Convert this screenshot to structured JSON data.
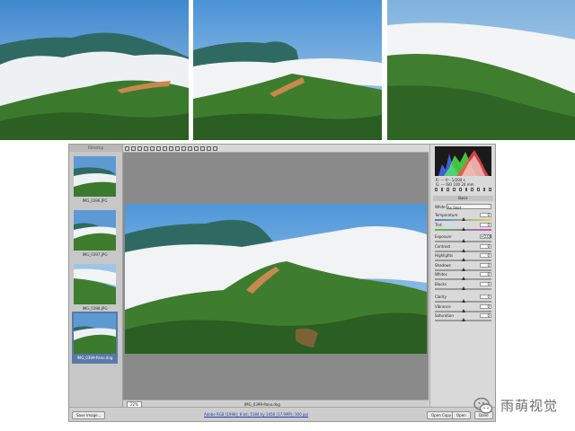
{
  "filmstrip": {
    "header": "Filmstrip",
    "items": [
      {
        "caption": "IMG_0396.JPG",
        "selected": false
      },
      {
        "caption": "IMG_0397.JPG",
        "selected": false
      },
      {
        "caption": "IMG_0398.JPG",
        "selected": false
      },
      {
        "caption": "IMG_0399-Pano.dng",
        "selected": true
      }
    ]
  },
  "toolbar": {
    "tools": [
      "zoom-icon",
      "hand-icon",
      "white-balance-icon",
      "color-sampler-icon",
      "target-adjust-icon",
      "crop-icon",
      "straighten-icon",
      "spot-removal-icon",
      "red-eye-icon",
      "adjustment-brush-icon",
      "graduated-filter-icon",
      "radial-filter-icon",
      "preferences-icon",
      "rotate-left-icon",
      "rotate-right-icon"
    ]
  },
  "zoom": {
    "value": "22%"
  },
  "canvas": {
    "filename": "IMG_0399-Pano.dng"
  },
  "histogram": {
    "readout_r": "R: ---    f/-- 1/200 s",
    "readout_g": "G: ---    ISO 100  24 mm",
    "readout_b": "B: ---"
  },
  "panel": {
    "section_title": "Basic",
    "white_balance_label": "White Balance",
    "white_balance_value": "As Shot",
    "sliders": [
      {
        "label": "Temperature",
        "value": "0",
        "pos": 0.5,
        "track": "temp"
      },
      {
        "label": "Tint",
        "value": "0",
        "pos": 0.5,
        "track": "tint"
      },
      {
        "label": "Exposure",
        "value": "+0.00",
        "pos": 0.5,
        "track": ""
      },
      {
        "label": "Contrast",
        "value": "0",
        "pos": 0.5,
        "track": ""
      },
      {
        "label": "Highlights",
        "value": "0",
        "pos": 0.5,
        "track": ""
      },
      {
        "label": "Shadows",
        "value": "0",
        "pos": 0.5,
        "track": ""
      },
      {
        "label": "Whites",
        "value": "0",
        "pos": 0.5,
        "track": ""
      },
      {
        "label": "Blacks",
        "value": "0",
        "pos": 0.5,
        "track": ""
      },
      {
        "label": "Clarity",
        "value": "0",
        "pos": 0.5,
        "track": ""
      },
      {
        "label": "Vibrance",
        "value": "0",
        "pos": 0.5,
        "track": ""
      },
      {
        "label": "Saturation",
        "value": "0",
        "pos": 0.5,
        "track": ""
      }
    ]
  },
  "footer": {
    "save_label": "Save Image...",
    "workflow_link": "Adobe RGB (1998); 8 bit; 5184 by 3456 (17.9MP); 300 ppi",
    "open_copy_label": "Open Copy",
    "open_label": "Open",
    "done_label": "Done"
  },
  "watermark": {
    "text": "雨萌视觉"
  },
  "colors": {
    "sky": "#5e9fd6",
    "cloud": "#f4f5f7",
    "forest": "#3f7a2e",
    "panel": "#d9d9d9",
    "canvas": "#8a8a8a"
  }
}
